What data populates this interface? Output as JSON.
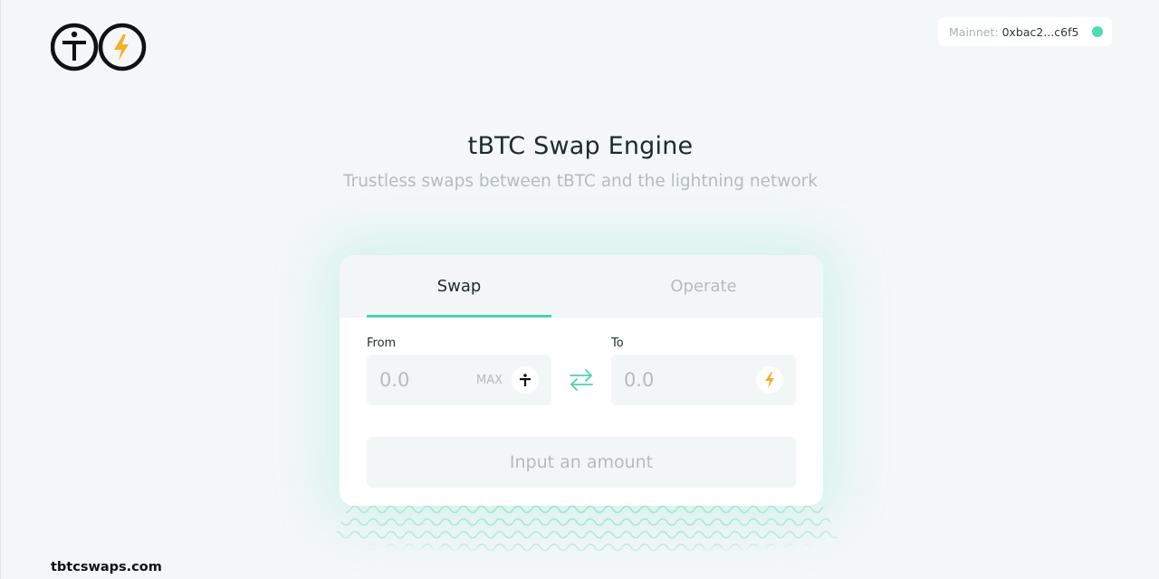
{
  "header": {
    "logo_icons": [
      "tbtc-icon",
      "lightning-icon"
    ],
    "wallet": {
      "network_label": "Mainnet:",
      "address": "0xbac2...c6f5",
      "status_color": "#4ddbb3"
    }
  },
  "hero": {
    "title": "tBTC Swap Engine",
    "subtitle": "Trustless swaps between tBTC and the lightning network"
  },
  "card": {
    "tabs": [
      {
        "label": "Swap",
        "active": true
      },
      {
        "label": "Operate",
        "active": false
      }
    ],
    "from": {
      "label": "From",
      "placeholder": "0.0",
      "max_label": "MAX",
      "token_icon": "tbtc-icon"
    },
    "to": {
      "label": "To",
      "placeholder": "0.0",
      "token_icon": "lightning-icon"
    },
    "swap_icon": "swap-arrows-icon",
    "submit_label": "Input an amount"
  },
  "footer": {
    "link_text": "tbtcswaps.com"
  },
  "colors": {
    "accent": "#4fd1b0",
    "lightning": "#f1b128",
    "muted": "#b4bcbc",
    "background": "#f3f7f7"
  }
}
